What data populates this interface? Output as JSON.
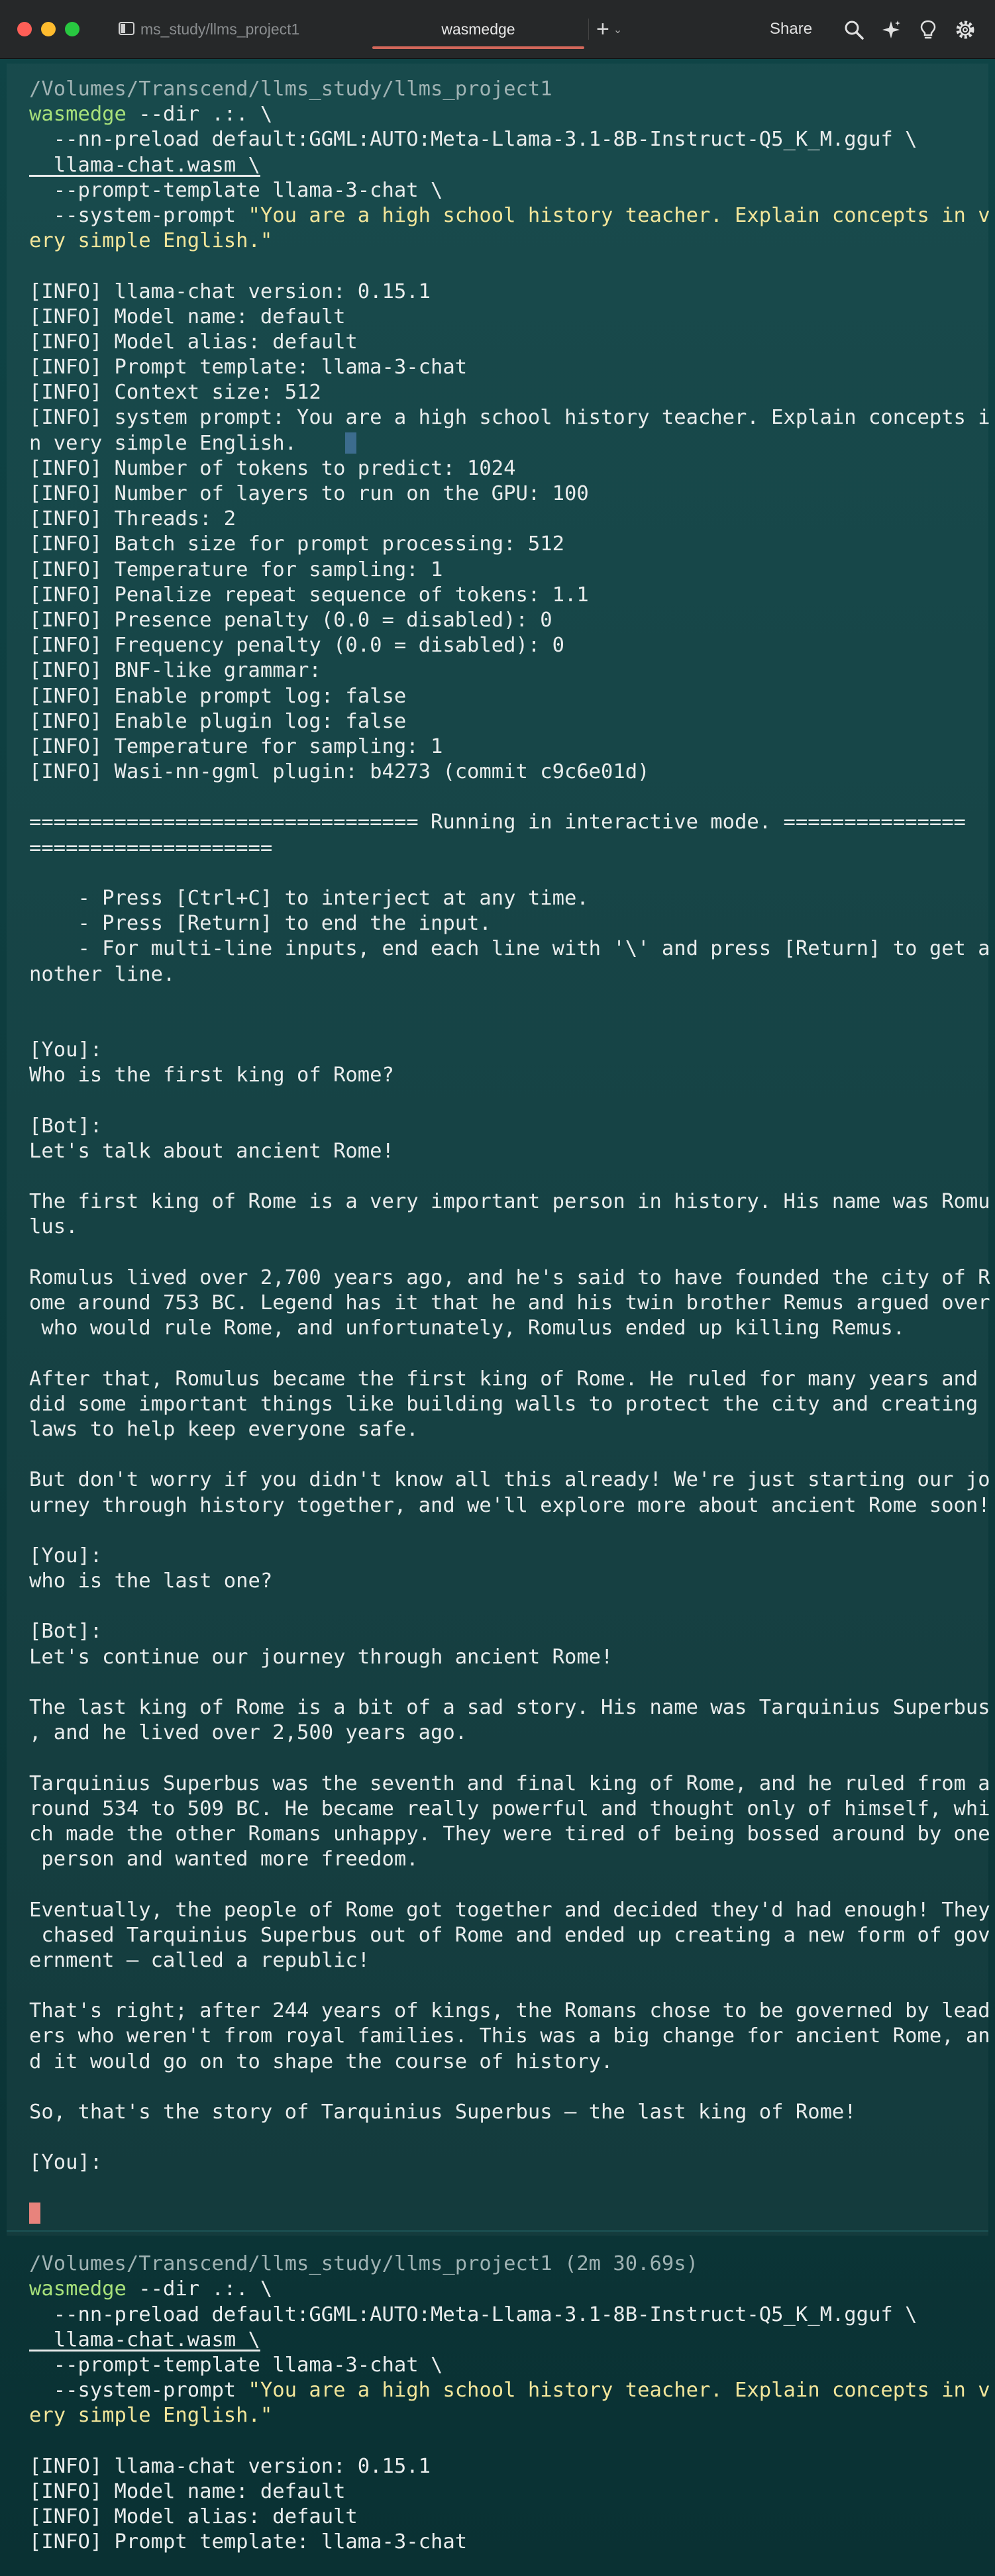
{
  "window": {
    "tabs": [
      {
        "label": "ms_study/llms_project1",
        "active": false
      },
      {
        "label": "wasmedge",
        "active": true
      }
    ],
    "new_tab_label": "+",
    "share_label": "Share",
    "icons": [
      "search-icon",
      "sparkle-icon",
      "lightbulb-icon",
      "gear-icon"
    ],
    "colors": {
      "background": "#0e3b3c",
      "accent_tab": "#d2675a",
      "prompt": "#a7e07a",
      "string": "#f2e59a",
      "cursor": "#e8837c"
    }
  },
  "session1": {
    "cwd": "/Volumes/Transcend/llms_study/llms_project1",
    "cmd": "wasmedge",
    "cmd_rest": " --dir .:. \\",
    "args": [
      "  --nn-preload default:GGML:AUTO:Meta-Llama-3.1-8B-Instruct-Q5_K_M.gguf \\",
      "  llama-chat.wasm \\",
      "  --prompt-template llama-3-chat \\"
    ],
    "sys_prefix": "  --system-prompt ",
    "sys_str1": "\"You are a high school history teacher. Explain concepts in v",
    "sys_str2": "ery simple English.\"",
    "info": [
      "[INFO] llama-chat version: 0.15.1",
      "[INFO] Model name: default",
      "[INFO] Model alias: default",
      "[INFO] Prompt template: llama-3-chat",
      "[INFO] Context size: 512",
      "[INFO] system prompt: You are a high school history teacher. Explain concepts i",
      "n very simple English.",
      "[INFO] Number of tokens to predict: 1024",
      "[INFO] Number of layers to run on the GPU: 100",
      "[INFO] Threads: 2",
      "[INFO] Batch size for prompt processing: 512",
      "[INFO] Temperature for sampling: 1",
      "[INFO] Penalize repeat sequence of tokens: 1.1",
      "[INFO] Presence penalty (0.0 = disabled): 0",
      "[INFO] Frequency penalty (0.0 = disabled): 0",
      "[INFO] BNF-like grammar:",
      "[INFO] Enable prompt log: false",
      "[INFO] Enable plugin log: false",
      "[INFO] Temperature for sampling: 1",
      "[INFO] Wasi-nn-ggml plugin: b4273 (commit c9c6e01d)"
    ],
    "banner": [
      "================================ Running in interactive mode. ===============",
      "===================="
    ],
    "help": [
      "    - Press [Ctrl+C] to interject at any time.",
      "    - Press [Return] to end the input.",
      "    - For multi-line inputs, end each line with '\\' and press [Return] to get a",
      "nother line."
    ],
    "chat1": [
      "[You]:",
      "Who is the first king of Rome?",
      "",
      "[Bot]:",
      "Let's talk about ancient Rome!",
      "",
      "The first king of Rome is a very important person in history. His name was Romu",
      "lus.",
      "",
      "Romulus lived over 2,700 years ago, and he's said to have founded the city of R",
      "ome around 753 BC. Legend has it that he and his twin brother Remus argued over",
      " who would rule Rome, and unfortunately, Romulus ended up killing Remus.",
      "",
      "After that, Romulus became the first king of Rome. He ruled for many years and",
      "did some important things like building walls to protect the city and creating",
      "laws to help keep everyone safe.",
      "",
      "But don't worry if you didn't know all this already! We're just starting our jo",
      "urney through history together, and we'll explore more about ancient Rome soon!",
      "",
      "[You]:",
      "who is the last one?",
      "",
      "[Bot]:",
      "Let's continue our journey through ancient Rome!",
      "",
      "The last king of Rome is a bit of a sad story. His name was Tarquinius Superbus",
      ", and he lived over 2,500 years ago.",
      "",
      "Tarquinius Superbus was the seventh and final king of Rome, and he ruled from a",
      "round 534 to 509 BC. He became really powerful and thought only of himself, whi",
      "ch made the other Romans unhappy. They were tired of being bossed around by one",
      " person and wanted more freedom.",
      "",
      "Eventually, the people of Rome got together and decided they'd had enough! They",
      " chased Tarquinius Superbus out of Rome and ended up creating a new form of gov",
      "ernment – called a republic!",
      "",
      "That's right; after 244 years of kings, the Romans chose to be governed by lead",
      "ers who weren't from royal families. This was a big change for ancient Rome, an",
      "d it would go on to shape the course of history.",
      "",
      "So, that's the story of Tarquinius Superbus – the last king of Rome!",
      "",
      "[You]:"
    ]
  },
  "session2": {
    "cwd": "/Volumes/Transcend/llms_study/llms_project1 (2m 30.69s)",
    "cmd": "wasmedge",
    "cmd_rest": " --dir .:. \\",
    "args": [
      "  --nn-preload default:GGML:AUTO:Meta-Llama-3.1-8B-Instruct-Q5_K_M.gguf \\",
      "  llama-chat.wasm \\",
      "  --prompt-template llama-3-chat \\"
    ],
    "sys_prefix": "  --system-prompt ",
    "sys_str1": "\"You are a high school history teacher. Explain concepts in v",
    "sys_str2": "ery simple English.\"",
    "info": [
      "[INFO] llama-chat version: 0.15.1",
      "[INFO] Model name: default",
      "[INFO] Model alias: default",
      "[INFO] Prompt template: llama-3-chat"
    ]
  }
}
